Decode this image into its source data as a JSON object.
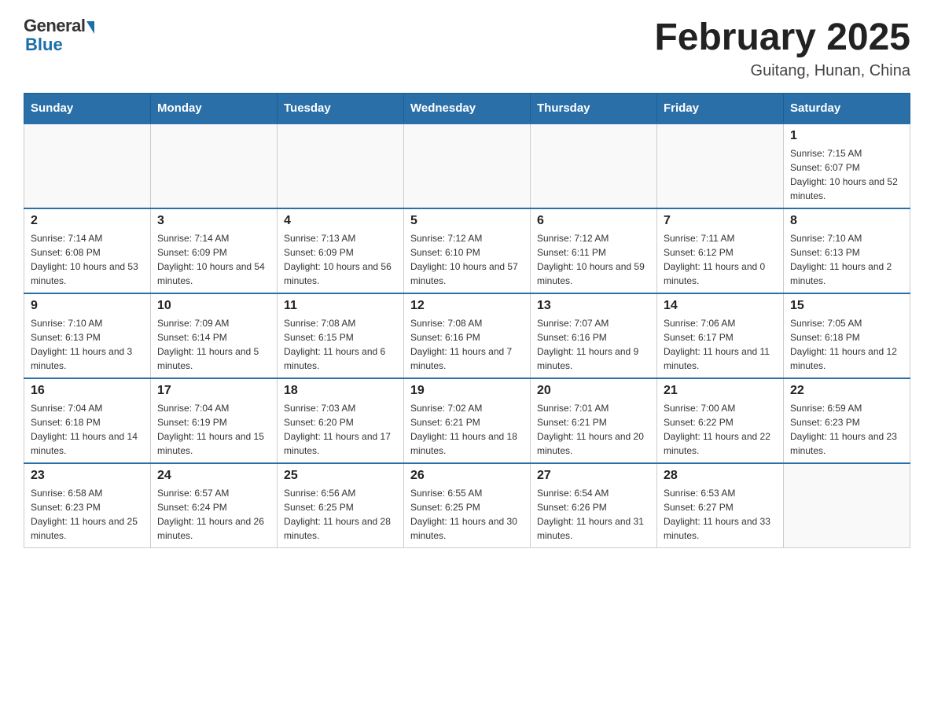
{
  "header": {
    "logo_general": "General",
    "logo_blue": "Blue",
    "month_title": "February 2025",
    "location": "Guitang, Hunan, China"
  },
  "days_of_week": [
    "Sunday",
    "Monday",
    "Tuesday",
    "Wednesday",
    "Thursday",
    "Friday",
    "Saturday"
  ],
  "weeks": [
    {
      "days": [
        {
          "number": "",
          "info": ""
        },
        {
          "number": "",
          "info": ""
        },
        {
          "number": "",
          "info": ""
        },
        {
          "number": "",
          "info": ""
        },
        {
          "number": "",
          "info": ""
        },
        {
          "number": "",
          "info": ""
        },
        {
          "number": "1",
          "info": "Sunrise: 7:15 AM\nSunset: 6:07 PM\nDaylight: 10 hours and 52 minutes."
        }
      ]
    },
    {
      "days": [
        {
          "number": "2",
          "info": "Sunrise: 7:14 AM\nSunset: 6:08 PM\nDaylight: 10 hours and 53 minutes."
        },
        {
          "number": "3",
          "info": "Sunrise: 7:14 AM\nSunset: 6:09 PM\nDaylight: 10 hours and 54 minutes."
        },
        {
          "number": "4",
          "info": "Sunrise: 7:13 AM\nSunset: 6:09 PM\nDaylight: 10 hours and 56 minutes."
        },
        {
          "number": "5",
          "info": "Sunrise: 7:12 AM\nSunset: 6:10 PM\nDaylight: 10 hours and 57 minutes."
        },
        {
          "number": "6",
          "info": "Sunrise: 7:12 AM\nSunset: 6:11 PM\nDaylight: 10 hours and 59 minutes."
        },
        {
          "number": "7",
          "info": "Sunrise: 7:11 AM\nSunset: 6:12 PM\nDaylight: 11 hours and 0 minutes."
        },
        {
          "number": "8",
          "info": "Sunrise: 7:10 AM\nSunset: 6:13 PM\nDaylight: 11 hours and 2 minutes."
        }
      ]
    },
    {
      "days": [
        {
          "number": "9",
          "info": "Sunrise: 7:10 AM\nSunset: 6:13 PM\nDaylight: 11 hours and 3 minutes."
        },
        {
          "number": "10",
          "info": "Sunrise: 7:09 AM\nSunset: 6:14 PM\nDaylight: 11 hours and 5 minutes."
        },
        {
          "number": "11",
          "info": "Sunrise: 7:08 AM\nSunset: 6:15 PM\nDaylight: 11 hours and 6 minutes."
        },
        {
          "number": "12",
          "info": "Sunrise: 7:08 AM\nSunset: 6:16 PM\nDaylight: 11 hours and 7 minutes."
        },
        {
          "number": "13",
          "info": "Sunrise: 7:07 AM\nSunset: 6:16 PM\nDaylight: 11 hours and 9 minutes."
        },
        {
          "number": "14",
          "info": "Sunrise: 7:06 AM\nSunset: 6:17 PM\nDaylight: 11 hours and 11 minutes."
        },
        {
          "number": "15",
          "info": "Sunrise: 7:05 AM\nSunset: 6:18 PM\nDaylight: 11 hours and 12 minutes."
        }
      ]
    },
    {
      "days": [
        {
          "number": "16",
          "info": "Sunrise: 7:04 AM\nSunset: 6:18 PM\nDaylight: 11 hours and 14 minutes."
        },
        {
          "number": "17",
          "info": "Sunrise: 7:04 AM\nSunset: 6:19 PM\nDaylight: 11 hours and 15 minutes."
        },
        {
          "number": "18",
          "info": "Sunrise: 7:03 AM\nSunset: 6:20 PM\nDaylight: 11 hours and 17 minutes."
        },
        {
          "number": "19",
          "info": "Sunrise: 7:02 AM\nSunset: 6:21 PM\nDaylight: 11 hours and 18 minutes."
        },
        {
          "number": "20",
          "info": "Sunrise: 7:01 AM\nSunset: 6:21 PM\nDaylight: 11 hours and 20 minutes."
        },
        {
          "number": "21",
          "info": "Sunrise: 7:00 AM\nSunset: 6:22 PM\nDaylight: 11 hours and 22 minutes."
        },
        {
          "number": "22",
          "info": "Sunrise: 6:59 AM\nSunset: 6:23 PM\nDaylight: 11 hours and 23 minutes."
        }
      ]
    },
    {
      "days": [
        {
          "number": "23",
          "info": "Sunrise: 6:58 AM\nSunset: 6:23 PM\nDaylight: 11 hours and 25 minutes."
        },
        {
          "number": "24",
          "info": "Sunrise: 6:57 AM\nSunset: 6:24 PM\nDaylight: 11 hours and 26 minutes."
        },
        {
          "number": "25",
          "info": "Sunrise: 6:56 AM\nSunset: 6:25 PM\nDaylight: 11 hours and 28 minutes."
        },
        {
          "number": "26",
          "info": "Sunrise: 6:55 AM\nSunset: 6:25 PM\nDaylight: 11 hours and 30 minutes."
        },
        {
          "number": "27",
          "info": "Sunrise: 6:54 AM\nSunset: 6:26 PM\nDaylight: 11 hours and 31 minutes."
        },
        {
          "number": "28",
          "info": "Sunrise: 6:53 AM\nSunset: 6:27 PM\nDaylight: 11 hours and 33 minutes."
        },
        {
          "number": "",
          "info": ""
        }
      ]
    }
  ]
}
